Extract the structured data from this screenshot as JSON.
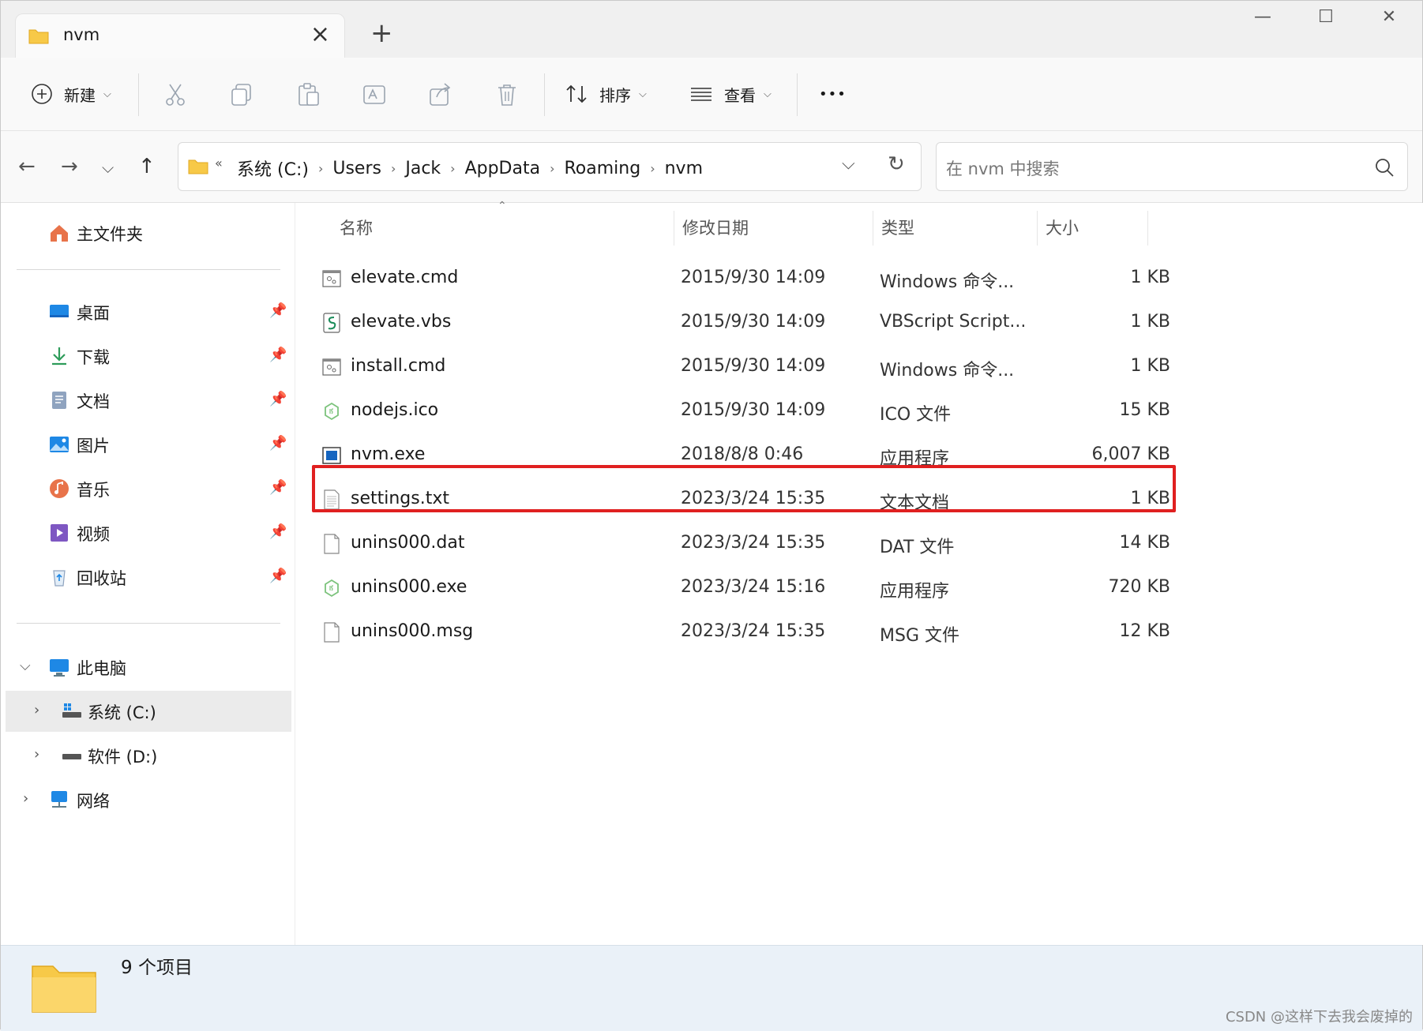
{
  "tab": {
    "title": "nvm",
    "new_tab": "+"
  },
  "window_controls": {
    "minimize": "—",
    "maximize": "☐",
    "close": "✕"
  },
  "toolbar": {
    "new_label": "新建",
    "sort_label": "排序",
    "view_label": "查看",
    "more_label": "•••"
  },
  "breadcrumbs": [
    "系统 (C:)",
    "Users",
    "Jack",
    "AppData",
    "Roaming",
    "nvm"
  ],
  "breadcrumb_prefix": "«",
  "search": {
    "placeholder": "在 nvm 中搜索"
  },
  "sidebar": {
    "home": "主文件夹",
    "quick_access": [
      {
        "label": "桌面",
        "icon": "desktop-icon"
      },
      {
        "label": "下载",
        "icon": "download-icon"
      },
      {
        "label": "文档",
        "icon": "documents-icon"
      },
      {
        "label": "图片",
        "icon": "pictures-icon"
      },
      {
        "label": "音乐",
        "icon": "music-icon"
      },
      {
        "label": "视频",
        "icon": "videos-icon"
      },
      {
        "label": "回收站",
        "icon": "recycle-bin-icon"
      }
    ],
    "this_pc": "此电脑",
    "drives": [
      "系统 (C:)",
      "软件 (D:)"
    ],
    "network": "网络"
  },
  "columns": {
    "name": "名称",
    "date": "修改日期",
    "type": "类型",
    "size": "大小"
  },
  "files": [
    {
      "name": "elevate.cmd",
      "date": "2015/9/30 14:09",
      "type": "Windows 命令...",
      "size": "1 KB",
      "icon": "cmd-file-icon"
    },
    {
      "name": "elevate.vbs",
      "date": "2015/9/30 14:09",
      "type": "VBScript Script...",
      "size": "1 KB",
      "icon": "vbs-file-icon"
    },
    {
      "name": "install.cmd",
      "date": "2015/9/30 14:09",
      "type": "Windows 命令...",
      "size": "1 KB",
      "icon": "cmd-file-icon"
    },
    {
      "name": "nodejs.ico",
      "date": "2015/9/30 14:09",
      "type": "ICO 文件",
      "size": "15 KB",
      "icon": "nodejs-icon"
    },
    {
      "name": "nvm.exe",
      "date": "2018/8/8 0:46",
      "type": "应用程序",
      "size": "6,007 KB",
      "icon": "exe-file-icon"
    },
    {
      "name": "settings.txt",
      "date": "2023/3/24 15:35",
      "type": "文本文档",
      "size": "1 KB",
      "icon": "text-file-icon"
    },
    {
      "name": "unins000.dat",
      "date": "2023/3/24 15:35",
      "type": "DAT 文件",
      "size": "14 KB",
      "icon": "blank-file-icon"
    },
    {
      "name": "unins000.exe",
      "date": "2023/3/24 15:16",
      "type": "应用程序",
      "size": "720 KB",
      "icon": "nodejs-icon"
    },
    {
      "name": "unins000.msg",
      "date": "2023/3/24 15:35",
      "type": "MSG 文件",
      "size": "12 KB",
      "icon": "blank-file-icon"
    }
  ],
  "status": {
    "count": "9 个项目"
  },
  "watermark": "CSDN @这样下去我会废掉的",
  "colors": {
    "highlight": "#e02020",
    "folder": "#f7c948",
    "status_bg": "#eaf1f8"
  }
}
